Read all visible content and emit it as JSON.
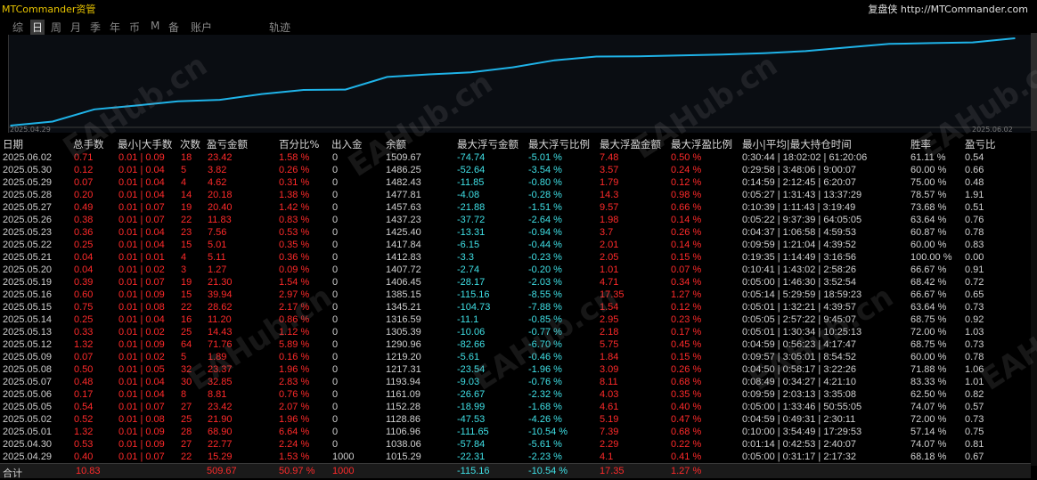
{
  "window": {
    "title": "MTCommander资管",
    "site": "复盘侠 http://MTCommander.com"
  },
  "tabs": [
    {
      "label": "综",
      "active": false
    },
    {
      "label": "日",
      "active": true
    },
    {
      "label": "周",
      "active": false
    },
    {
      "label": "月",
      "active": false
    },
    {
      "label": "季",
      "active": false
    },
    {
      "label": "年",
      "active": false
    },
    {
      "label": "币",
      "active": false
    },
    {
      "label": "M",
      "active": false
    },
    {
      "label": "备",
      "active": false
    },
    {
      "label": "账户",
      "active": false
    },
    {
      "label": "轨迹",
      "active": false
    }
  ],
  "chart_data": {
    "type": "line",
    "x_start_label": "2025.04.29",
    "x_end_label": "2025.06.02",
    "line_color": "#1fb3e8",
    "series": [
      {
        "x": [
          "2025.04.29",
          "2025.04.30",
          "2025.05.01",
          "2025.05.02",
          "2025.05.05",
          "2025.05.06",
          "2025.05.07",
          "2025.05.08",
          "2025.05.09",
          "2025.05.12",
          "2025.05.13",
          "2025.05.14",
          "2025.05.15",
          "2025.05.16",
          "2025.05.19",
          "2025.05.20",
          "2025.05.21",
          "2025.05.22",
          "2025.05.23",
          "2025.05.26",
          "2025.05.27",
          "2025.05.28",
          "2025.05.29",
          "2025.05.30",
          "2025.06.02"
        ],
        "values": [
          1015.29,
          1038.06,
          1106.96,
          1128.86,
          1152.28,
          1161.09,
          1193.94,
          1217.31,
          1219.2,
          1290.96,
          1305.39,
          1316.59,
          1345.21,
          1385.15,
          1406.45,
          1407.72,
          1412.83,
          1417.84,
          1425.4,
          1437.23,
          1457.63,
          1477.81,
          1482.43,
          1486.25,
          1509.67
        ]
      }
    ]
  },
  "table": {
    "headers": [
      "日期",
      "总手数",
      "最小|大手数",
      "次数",
      "盈亏金额",
      "百分比%",
      "出入金",
      "余额",
      "最大浮亏金额",
      "最大浮亏比例",
      "最大浮盈金额",
      "最大浮盈比例",
      "最小|平均|最大持仓时间",
      "胜率",
      "盈亏比"
    ],
    "rows": [
      [
        "2025.06.02",
        "0.71",
        "0.01 | 0.09",
        "18",
        "23.42",
        "1.58 %",
        "0",
        "1509.67",
        "-74.74",
        "-5.01 %",
        "7.48",
        "0.50 %",
        "0:30:44 | 18:02:02 | 61:20:06",
        "61.11 %",
        "0.54"
      ],
      [
        "2025.05.30",
        "0.12",
        "0.01 | 0.04",
        "5",
        "3.82",
        "0.26 %",
        "0",
        "1486.25",
        "-52.64",
        "-3.54 %",
        "3.57",
        "0.24 %",
        "0:29:58 | 3:48:06 | 9:00:07",
        "60.00 %",
        "0.66"
      ],
      [
        "2025.05.29",
        "0.07",
        "0.01 | 0.04",
        "4",
        "4.62",
        "0.31 %",
        "0",
        "1482.43",
        "-11.85",
        "-0.80 %",
        "1.79",
        "0.12 %",
        "0:14:59 | 2:12:45 | 6:20:07",
        "75.00 %",
        "0.48"
      ],
      [
        "2025.05.28",
        "0.20",
        "0.01 | 0.04",
        "14",
        "20.18",
        "1.38 %",
        "0",
        "1477.81",
        "-4.08",
        "-0.28 %",
        "14.3",
        "0.98 %",
        "0:05:27 | 1:31:43 | 13:37:29",
        "78.57 %",
        "1.91"
      ],
      [
        "2025.05.27",
        "0.49",
        "0.01 | 0.07",
        "19",
        "20.40",
        "1.42 %",
        "0",
        "1457.63",
        "-21.88",
        "-1.51 %",
        "9.57",
        "0.66 %",
        "0:10:39 | 1:11:43 | 3:19:49",
        "73.68 %",
        "0.51"
      ],
      [
        "2025.05.26",
        "0.38",
        "0.01 | 0.07",
        "22",
        "11.83",
        "0.83 %",
        "0",
        "1437.23",
        "-37.72",
        "-2.64 %",
        "1.98",
        "0.14 %",
        "0:05:22 | 9:37:39 | 64:05:05",
        "63.64 %",
        "0.76"
      ],
      [
        "2025.05.23",
        "0.36",
        "0.01 | 0.04",
        "23",
        "7.56",
        "0.53 %",
        "0",
        "1425.40",
        "-13.31",
        "-0.94 %",
        "3.7",
        "0.26 %",
        "0:04:37 | 1:06:58 | 4:59:53",
        "60.87 %",
        "0.78"
      ],
      [
        "2025.05.22",
        "0.25",
        "0.01 | 0.04",
        "15",
        "5.01",
        "0.35 %",
        "0",
        "1417.84",
        "-6.15",
        "-0.44 %",
        "2.01",
        "0.14 %",
        "0:09:59 | 1:21:04 | 4:39:52",
        "60.00 %",
        "0.83"
      ],
      [
        "2025.05.21",
        "0.04",
        "0.01 | 0.01",
        "4",
        "5.11",
        "0.36 %",
        "0",
        "1412.83",
        "-3.3",
        "-0.23 %",
        "2.05",
        "0.15 %",
        "0:19:35 | 1:14:49 | 3:16:56",
        "100.00 %",
        "0.00"
      ],
      [
        "2025.05.20",
        "0.04",
        "0.01 | 0.02",
        "3",
        "1.27",
        "0.09 %",
        "0",
        "1407.72",
        "-2.74",
        "-0.20 %",
        "1.01",
        "0.07 %",
        "0:10:41 | 1:43:02 | 2:58:26",
        "66.67 %",
        "0.91"
      ],
      [
        "2025.05.19",
        "0.39",
        "0.01 | 0.07",
        "19",
        "21.30",
        "1.54 %",
        "0",
        "1406.45",
        "-28.17",
        "-2.03 %",
        "4.71",
        "0.34 %",
        "0:05:00 | 1:46:30 | 3:52:54",
        "68.42 %",
        "0.72"
      ],
      [
        "2025.05.16",
        "0.60",
        "0.01 | 0.09",
        "15",
        "39.94",
        "2.97 %",
        "0",
        "1385.15",
        "-115.16",
        "-8.55 %",
        "17.35",
        "1.27 %",
        "0:05:14 | 5:29:59 | 18:59:23",
        "66.67 %",
        "0.65"
      ],
      [
        "2025.05.15",
        "0.75",
        "0.01 | 0.08",
        "22",
        "28.62",
        "2.17 %",
        "0",
        "1345.21",
        "-104.73",
        "-7.88 %",
        "1.54",
        "0.12 %",
        "0:05:01 | 1:32:21 | 4:39:57",
        "63.64 %",
        "0.73"
      ],
      [
        "2025.05.14",
        "0.25",
        "0.01 | 0.04",
        "16",
        "11.20",
        "0.86 %",
        "0",
        "1316.59",
        "-11.1",
        "-0.85 %",
        "2.95",
        "0.23 %",
        "0:05:05 | 2:57:22 | 9:45:07",
        "68.75 %",
        "0.92"
      ],
      [
        "2025.05.13",
        "0.33",
        "0.01 | 0.02",
        "25",
        "14.43",
        "1.12 %",
        "0",
        "1305.39",
        "-10.06",
        "-0.77 %",
        "2.18",
        "0.17 %",
        "0:05:01 | 1:30:34 | 10:25:13",
        "72.00 %",
        "1.03"
      ],
      [
        "2025.05.12",
        "1.32",
        "0.01 | 0.09",
        "64",
        "71.76",
        "5.89 %",
        "0",
        "1290.96",
        "-82.66",
        "-6.70 %",
        "5.75",
        "0.45 %",
        "0:04:59 | 0:56:23 | 4:17:47",
        "68.75 %",
        "0.73"
      ],
      [
        "2025.05.09",
        "0.07",
        "0.01 | 0.02",
        "5",
        "1.89",
        "0.16 %",
        "0",
        "1219.20",
        "-5.61",
        "-0.46 %",
        "1.84",
        "0.15 %",
        "0:09:57 | 3:05:01 | 8:54:52",
        "60.00 %",
        "0.78"
      ],
      [
        "2025.05.08",
        "0.50",
        "0.01 | 0.05",
        "32",
        "23.37",
        "1.96 %",
        "0",
        "1217.31",
        "-23.54",
        "-1.96 %",
        "3.09",
        "0.26 %",
        "0:04:50 | 0:58:17 | 3:22:26",
        "71.88 %",
        "1.06"
      ],
      [
        "2025.05.07",
        "0.48",
        "0.01 | 0.04",
        "30",
        "32.85",
        "2.83 %",
        "0",
        "1193.94",
        "-9.03",
        "-0.76 %",
        "8.11",
        "0.68 %",
        "0:08:49 | 0:34:27 | 4:21:10",
        "83.33 %",
        "1.01"
      ],
      [
        "2025.05.06",
        "0.17",
        "0.01 | 0.04",
        "8",
        "8.81",
        "0.76 %",
        "0",
        "1161.09",
        "-26.67",
        "-2.32 %",
        "4.03",
        "0.35 %",
        "0:09:59 | 2:03:13 | 3:35:08",
        "62.50 %",
        "0.82"
      ],
      [
        "2025.05.05",
        "0.54",
        "0.01 | 0.07",
        "27",
        "23.42",
        "2.07 %",
        "0",
        "1152.28",
        "-18.99",
        "-1.68 %",
        "4.61",
        "0.40 %",
        "0:05:00 | 1:33:46 | 50:55:05",
        "74.07 %",
        "0.57"
      ],
      [
        "2025.05.02",
        "0.52",
        "0.01 | 0.08",
        "25",
        "21.90",
        "1.96 %",
        "0",
        "1128.86",
        "-47.53",
        "-4.26 %",
        "5.19",
        "0.47 %",
        "0:04:59 | 0:49:31 | 2:30:11",
        "72.00 %",
        "0.73"
      ],
      [
        "2025.05.01",
        "1.32",
        "0.01 | 0.09",
        "28",
        "68.90",
        "6.64 %",
        "0",
        "1106.96",
        "-111.65",
        "-10.54 %",
        "7.39",
        "0.68 %",
        "0:10:00 | 3:54:49 | 17:29:53",
        "57.14 %",
        "0.75"
      ],
      [
        "2025.04.30",
        "0.53",
        "0.01 | 0.09",
        "27",
        "22.77",
        "2.24 %",
        "0",
        "1038.06",
        "-57.84",
        "-5.61 %",
        "2.29",
        "0.22 %",
        "0:01:14 | 0:42:53 | 2:40:07",
        "74.07 %",
        "0.81"
      ],
      [
        "2025.04.29",
        "0.40",
        "0.01 | 0.07",
        "22",
        "15.29",
        "1.53 %",
        "1000",
        "1015.29",
        "-22.31",
        "-2.23 %",
        "4.1",
        "0.41 %",
        "0:05:00 | 0:31:17 | 2:17:32",
        "68.18 %",
        "0.67"
      ]
    ],
    "total": {
      "label": "合计",
      "lots": "10.83",
      "pnl": "509.67",
      "pct": "50.97 %",
      "deposit": "1000",
      "max_float_loss": "-115.16",
      "max_float_loss_pct": "-10.54 %",
      "max_float_profit": "17.35",
      "max_float_profit_pct": "1.27 %"
    }
  },
  "watermark": "EAHub.cn",
  "colors": {
    "accent": "#e8c400",
    "profit": "#ff2a2a",
    "loss": "#3fe0e6",
    "line": "#1fb3e8"
  }
}
